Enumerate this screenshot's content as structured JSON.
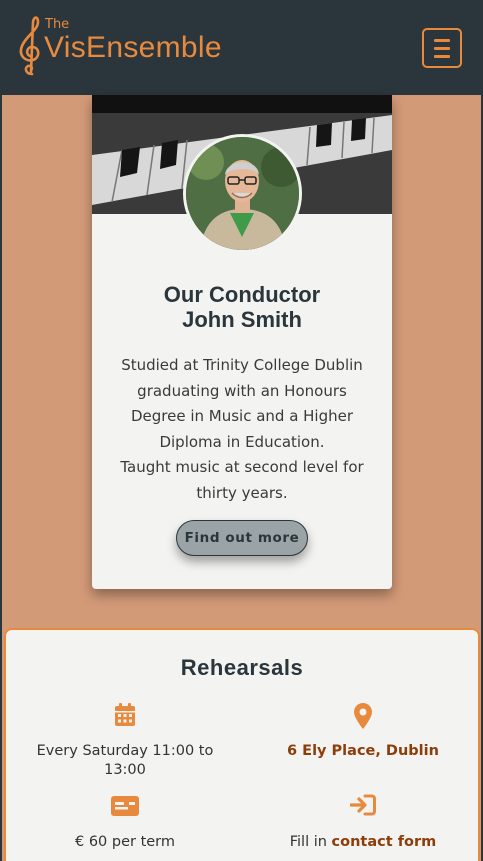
{
  "header": {
    "logo_the": "The",
    "logo_vis": "Vis",
    "logo_ensemble": "Ensemble",
    "brand_color": "#e88a3e",
    "bg_color": "#2b353c"
  },
  "conductor": {
    "title": "Our Conductor",
    "name": "John Smith",
    "line1": "Studied at Trinity College Dublin graduating with an Honours Degree in Music and a Higher Diploma in Education.",
    "line2": "Taught music at second level for thirty years.",
    "button_label": "Find out more"
  },
  "rehearsals": {
    "title": "Rehearsals",
    "time": "Every Saturday 11:00 to 13:00",
    "location": "6 Ely Place, Dublin",
    "fee": "€ 60 per term",
    "signup_prefix": "Fill in ",
    "signup_link": "contact form",
    "icons": [
      "calendar-icon",
      "map-pin-icon",
      "ticket-icon",
      "sign-in-icon"
    ]
  }
}
